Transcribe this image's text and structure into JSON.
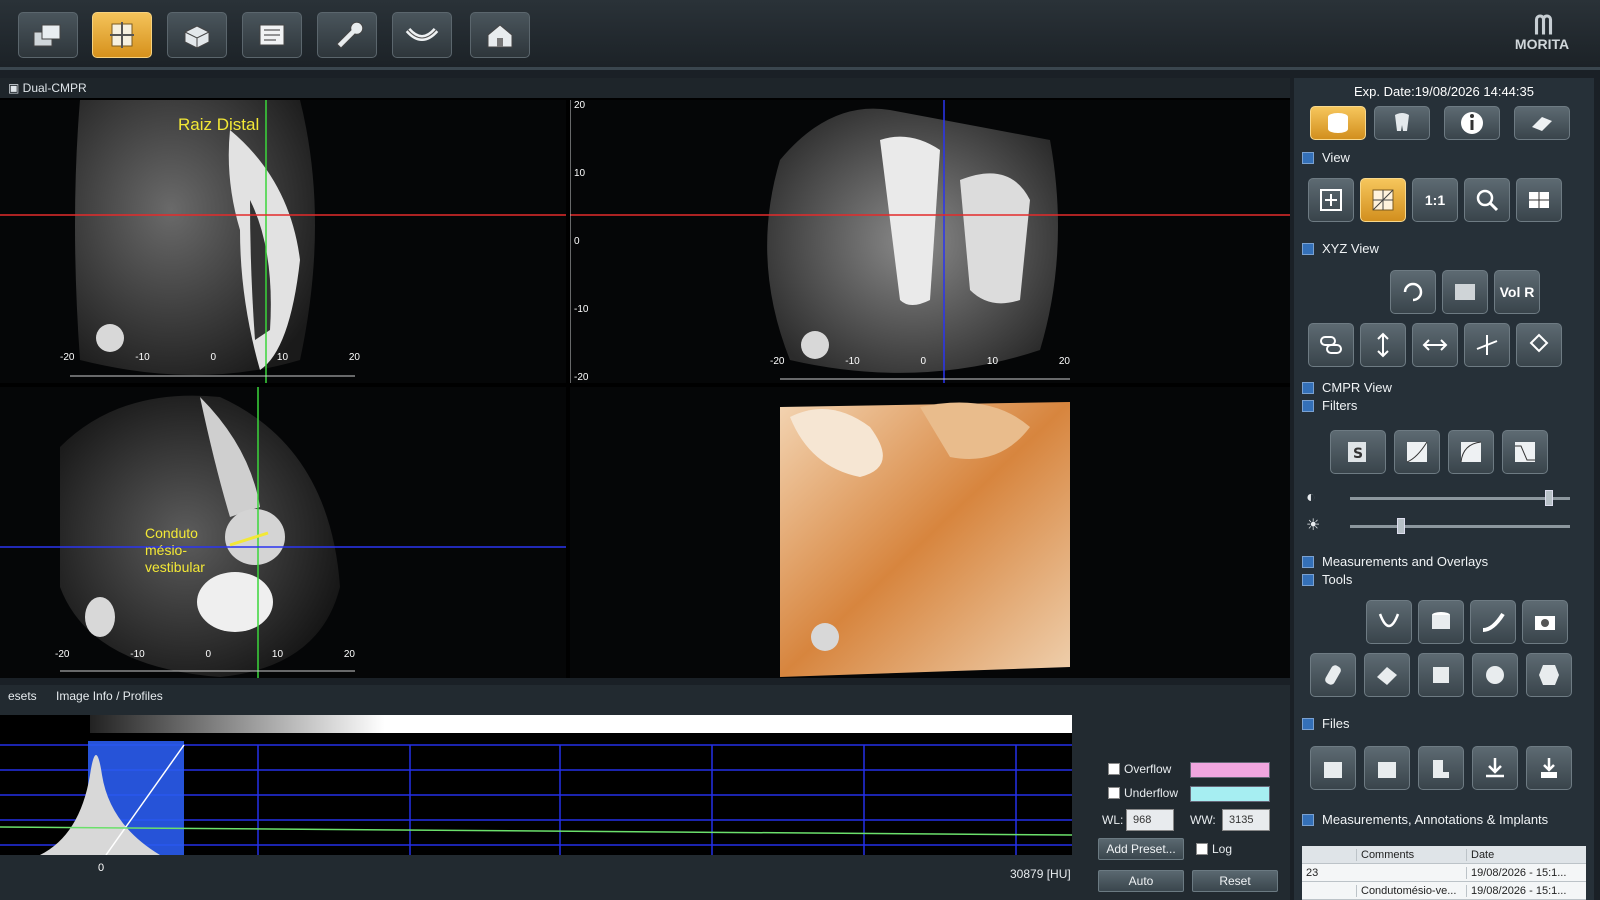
{
  "app": {
    "brand": "MORITA"
  },
  "toolbar": {
    "buttons": [
      {
        "icon": "layers-icon",
        "active": false
      },
      {
        "icon": "mpr-view-icon",
        "active": true
      },
      {
        "icon": "volume-icon",
        "active": false
      },
      {
        "icon": "report-icon",
        "active": false
      },
      {
        "icon": "wrench-icon",
        "active": false
      },
      {
        "icon": "dental-arch-icon",
        "active": false
      },
      {
        "icon": "home-icon",
        "active": false
      }
    ]
  },
  "viewer": {
    "title": "Dual-CMPR",
    "annotations": {
      "raiz": "Raiz Distal",
      "conduto_line1": "Conduto",
      "conduto_line2": "mésio-",
      "conduto_line3": "vestibular"
    },
    "axis_ticks": {
      "horizontal": [
        "-20",
        "-10",
        "0",
        "10",
        "20"
      ],
      "vertical": [
        "20",
        "10",
        "0",
        "-10",
        "-20"
      ]
    }
  },
  "bottom": {
    "tabs": [
      "esets",
      "Image Info / Profiles"
    ],
    "hist_zero": "0",
    "hu_max": "30879 [HU]",
    "overflow_label": "Overflow",
    "underflow_label": "Underflow",
    "wl_label": "WL:",
    "wl_value": "968",
    "ww_label": "WW:",
    "ww_value": "3135",
    "add_preset": "Add Preset...",
    "log_label": "Log",
    "auto": "Auto",
    "reset": "Reset",
    "colors": {
      "overflow": "#f2a6e0",
      "underflow": "#a6eef2"
    }
  },
  "right_panel": {
    "exp_date": "Exp. Date:19/08/2026 14:44:35",
    "sections": {
      "view": "View",
      "xyz_view": "XYZ View",
      "cmpr_view": "CMPR View",
      "filters": "Filters",
      "measurements_overlays": "Measurements and Overlays",
      "tools": "Tools",
      "files": "Files",
      "measurements_annotations": "Measurements, Annotations & Implants"
    },
    "vol_r_label": "Vol R",
    "one_to_one": "1:1",
    "slider_contrast": 0.92,
    "slider_brightness": 0.22,
    "table": {
      "headers": [
        "",
        "Comments",
        "Date"
      ],
      "rows": [
        {
          "id": "23",
          "comment": "",
          "date": "19/08/2026 - 15:1..."
        },
        {
          "id": "",
          "comment": "Condutomésio-ve...",
          "date": "19/08/2026 - 15:1..."
        }
      ]
    }
  }
}
